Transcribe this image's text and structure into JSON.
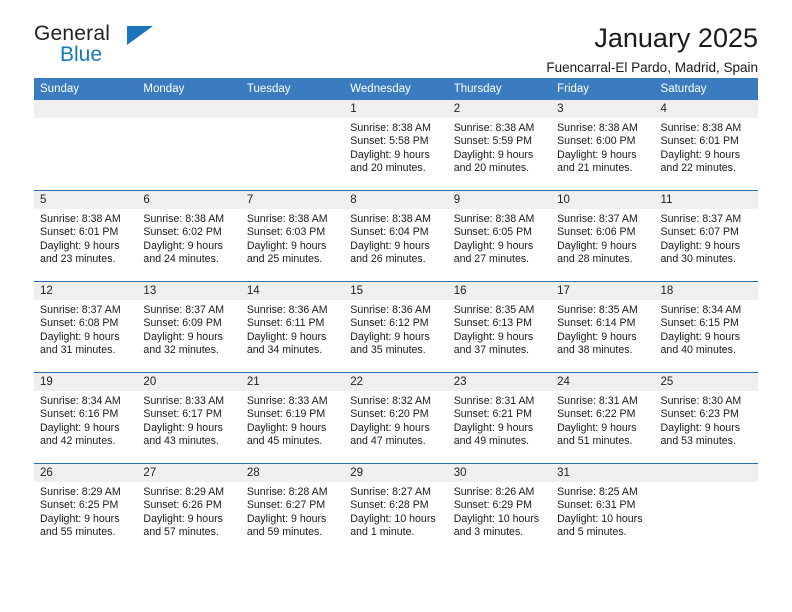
{
  "brand": {
    "name_top": "General",
    "name_bottom": "Blue",
    "accent_color": "#1b76bd"
  },
  "header": {
    "title": "January 2025",
    "subtitle": "Fuencarral-El Pardo, Madrid, Spain"
  },
  "theme": {
    "header_blue": "#3a7cbf",
    "row_divider_blue": "#2a6ead",
    "daynum_bg": "#efefef"
  },
  "weekdays": [
    "Sunday",
    "Monday",
    "Tuesday",
    "Wednesday",
    "Thursday",
    "Friday",
    "Saturday"
  ],
  "weeks": [
    [
      {
        "day": "",
        "lines": []
      },
      {
        "day": "",
        "lines": []
      },
      {
        "day": "",
        "lines": []
      },
      {
        "day": "1",
        "lines": [
          "Sunrise: 8:38 AM",
          "Sunset: 5:58 PM",
          "Daylight: 9 hours and 20 minutes."
        ]
      },
      {
        "day": "2",
        "lines": [
          "Sunrise: 8:38 AM",
          "Sunset: 5:59 PM",
          "Daylight: 9 hours and 20 minutes."
        ]
      },
      {
        "day": "3",
        "lines": [
          "Sunrise: 8:38 AM",
          "Sunset: 6:00 PM",
          "Daylight: 9 hours and 21 minutes."
        ]
      },
      {
        "day": "4",
        "lines": [
          "Sunrise: 8:38 AM",
          "Sunset: 6:01 PM",
          "Daylight: 9 hours and 22 minutes."
        ]
      }
    ],
    [
      {
        "day": "5",
        "lines": [
          "Sunrise: 8:38 AM",
          "Sunset: 6:01 PM",
          "Daylight: 9 hours and 23 minutes."
        ]
      },
      {
        "day": "6",
        "lines": [
          "Sunrise: 8:38 AM",
          "Sunset: 6:02 PM",
          "Daylight: 9 hours and 24 minutes."
        ]
      },
      {
        "day": "7",
        "lines": [
          "Sunrise: 8:38 AM",
          "Sunset: 6:03 PM",
          "Daylight: 9 hours and 25 minutes."
        ]
      },
      {
        "day": "8",
        "lines": [
          "Sunrise: 8:38 AM",
          "Sunset: 6:04 PM",
          "Daylight: 9 hours and 26 minutes."
        ]
      },
      {
        "day": "9",
        "lines": [
          "Sunrise: 8:38 AM",
          "Sunset: 6:05 PM",
          "Daylight: 9 hours and 27 minutes."
        ]
      },
      {
        "day": "10",
        "lines": [
          "Sunrise: 8:37 AM",
          "Sunset: 6:06 PM",
          "Daylight: 9 hours and 28 minutes."
        ]
      },
      {
        "day": "11",
        "lines": [
          "Sunrise: 8:37 AM",
          "Sunset: 6:07 PM",
          "Daylight: 9 hours and 30 minutes."
        ]
      }
    ],
    [
      {
        "day": "12",
        "lines": [
          "Sunrise: 8:37 AM",
          "Sunset: 6:08 PM",
          "Daylight: 9 hours and 31 minutes."
        ]
      },
      {
        "day": "13",
        "lines": [
          "Sunrise: 8:37 AM",
          "Sunset: 6:09 PM",
          "Daylight: 9 hours and 32 minutes."
        ]
      },
      {
        "day": "14",
        "lines": [
          "Sunrise: 8:36 AM",
          "Sunset: 6:11 PM",
          "Daylight: 9 hours and 34 minutes."
        ]
      },
      {
        "day": "15",
        "lines": [
          "Sunrise: 8:36 AM",
          "Sunset: 6:12 PM",
          "Daylight: 9 hours and 35 minutes."
        ]
      },
      {
        "day": "16",
        "lines": [
          "Sunrise: 8:35 AM",
          "Sunset: 6:13 PM",
          "Daylight: 9 hours and 37 minutes."
        ]
      },
      {
        "day": "17",
        "lines": [
          "Sunrise: 8:35 AM",
          "Sunset: 6:14 PM",
          "Daylight: 9 hours and 38 minutes."
        ]
      },
      {
        "day": "18",
        "lines": [
          "Sunrise: 8:34 AM",
          "Sunset: 6:15 PM",
          "Daylight: 9 hours and 40 minutes."
        ]
      }
    ],
    [
      {
        "day": "19",
        "lines": [
          "Sunrise: 8:34 AM",
          "Sunset: 6:16 PM",
          "Daylight: 9 hours and 42 minutes."
        ]
      },
      {
        "day": "20",
        "lines": [
          "Sunrise: 8:33 AM",
          "Sunset: 6:17 PM",
          "Daylight: 9 hours and 43 minutes."
        ]
      },
      {
        "day": "21",
        "lines": [
          "Sunrise: 8:33 AM",
          "Sunset: 6:19 PM",
          "Daylight: 9 hours and 45 minutes."
        ]
      },
      {
        "day": "22",
        "lines": [
          "Sunrise: 8:32 AM",
          "Sunset: 6:20 PM",
          "Daylight: 9 hours and 47 minutes."
        ]
      },
      {
        "day": "23",
        "lines": [
          "Sunrise: 8:31 AM",
          "Sunset: 6:21 PM",
          "Daylight: 9 hours and 49 minutes."
        ]
      },
      {
        "day": "24",
        "lines": [
          "Sunrise: 8:31 AM",
          "Sunset: 6:22 PM",
          "Daylight: 9 hours and 51 minutes."
        ]
      },
      {
        "day": "25",
        "lines": [
          "Sunrise: 8:30 AM",
          "Sunset: 6:23 PM",
          "Daylight: 9 hours and 53 minutes."
        ]
      }
    ],
    [
      {
        "day": "26",
        "lines": [
          "Sunrise: 8:29 AM",
          "Sunset: 6:25 PM",
          "Daylight: 9 hours and 55 minutes."
        ]
      },
      {
        "day": "27",
        "lines": [
          "Sunrise: 8:29 AM",
          "Sunset: 6:26 PM",
          "Daylight: 9 hours and 57 minutes."
        ]
      },
      {
        "day": "28",
        "lines": [
          "Sunrise: 8:28 AM",
          "Sunset: 6:27 PM",
          "Daylight: 9 hours and 59 minutes."
        ]
      },
      {
        "day": "29",
        "lines": [
          "Sunrise: 8:27 AM",
          "Sunset: 6:28 PM",
          "Daylight: 10 hours and 1 minute."
        ]
      },
      {
        "day": "30",
        "lines": [
          "Sunrise: 8:26 AM",
          "Sunset: 6:29 PM",
          "Daylight: 10 hours and 3 minutes."
        ]
      },
      {
        "day": "31",
        "lines": [
          "Sunrise: 8:25 AM",
          "Sunset: 6:31 PM",
          "Daylight: 10 hours and 5 minutes."
        ]
      },
      {
        "day": "",
        "lines": []
      }
    ]
  ]
}
